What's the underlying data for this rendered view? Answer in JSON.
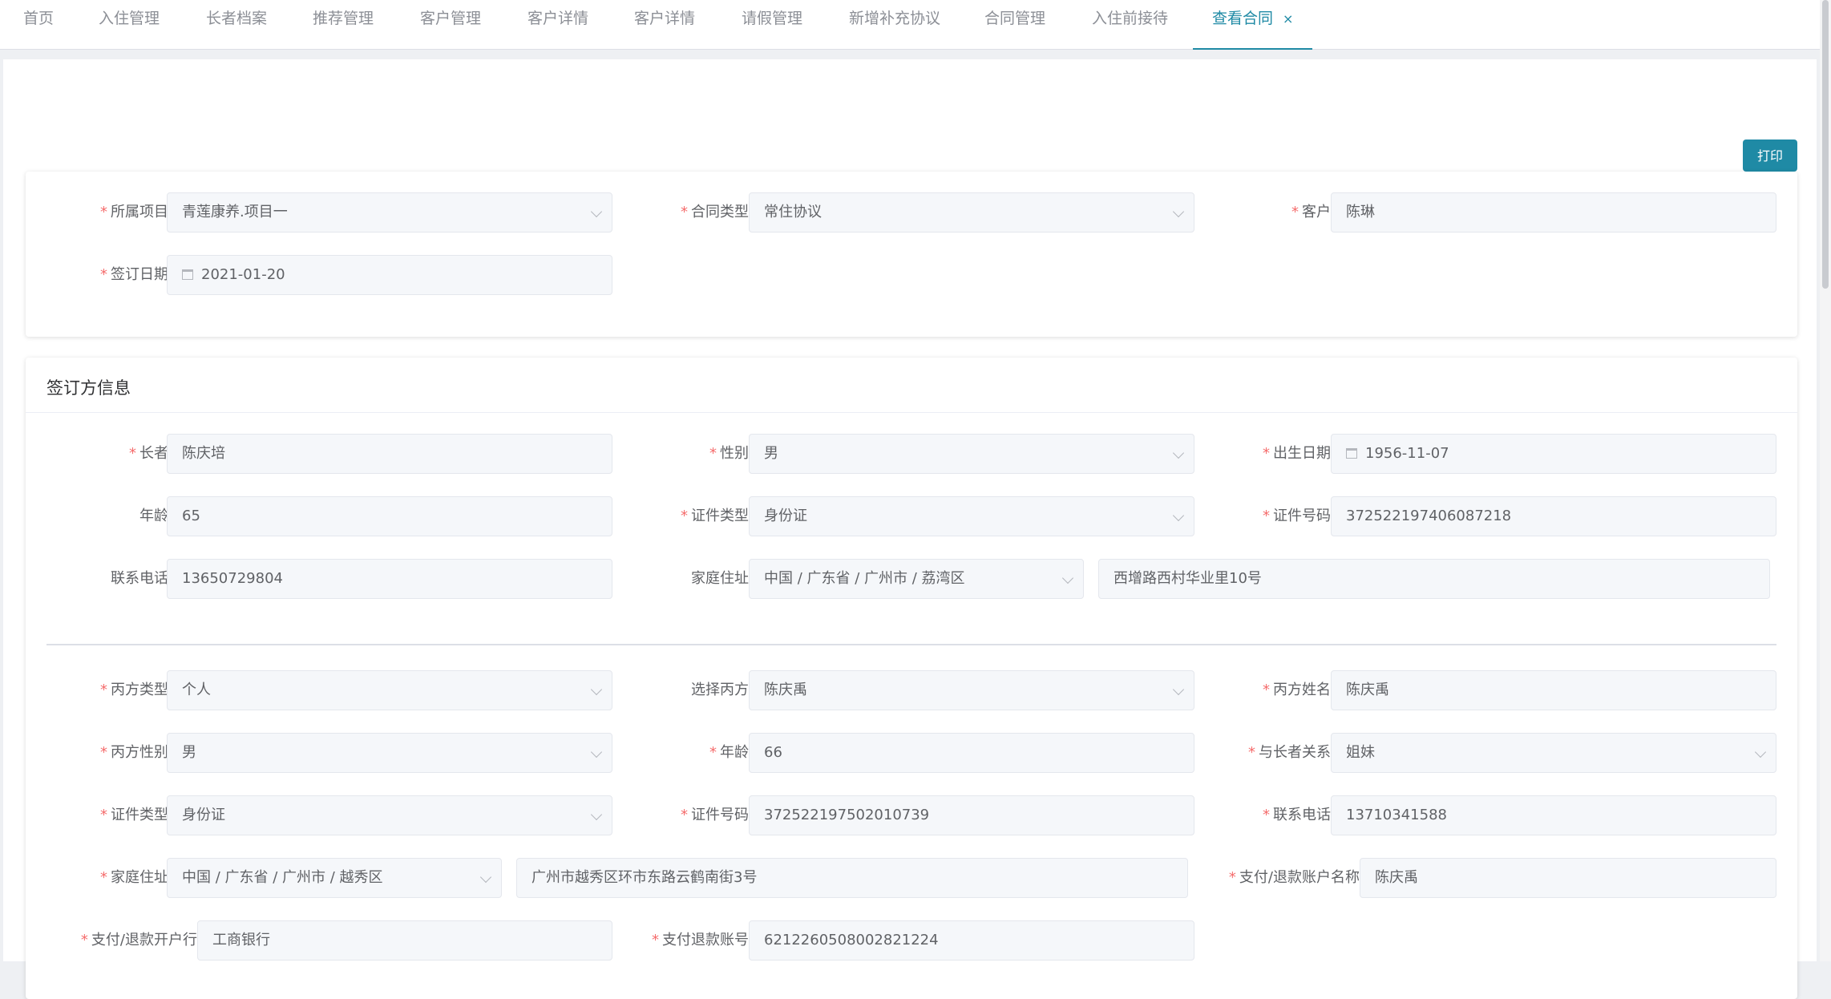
{
  "tabs": [
    {
      "label": "首页"
    },
    {
      "label": "入住管理"
    },
    {
      "label": "长者档案"
    },
    {
      "label": "推荐管理"
    },
    {
      "label": "客户管理"
    },
    {
      "label": "客户详情"
    },
    {
      "label": "客户详情"
    },
    {
      "label": "请假管理"
    },
    {
      "label": "新增补充协议"
    },
    {
      "label": "合同管理"
    },
    {
      "label": "入住前接待"
    },
    {
      "label": "查看合同"
    }
  ],
  "print_label": "打印",
  "contract": {
    "project_label": "所属项目",
    "project_value": "青莲康养.项目一",
    "type_label": "合同类型",
    "type_value": "常住协议",
    "customer_label": "客户",
    "customer_value": "陈琳",
    "date_label": "签订日期",
    "date_value": "2021-01-20"
  },
  "party": {
    "title": "签订方信息",
    "elder_label": "长者",
    "elder_value": "陈庆培",
    "gender_label": "性别",
    "gender_value": "男",
    "birth_label": "出生日期",
    "birth_value": "1956-11-07",
    "age_label": "年龄",
    "age_value": "65",
    "idtype_label": "证件类型",
    "idtype_value": "身份证",
    "idno_label": "证件号码",
    "idno_value": "372522197406087218",
    "phone_label": "联系电话",
    "phone_value": "13650729804",
    "addr_label": "家庭住址",
    "addr_region": "中国 / 广东省 / 广州市 / 荔湾区",
    "addr_detail": "西增路西村华业里10号"
  },
  "partyC": {
    "ctype_label": "丙方类型",
    "ctype_value": "个人",
    "select_label": "选择丙方",
    "select_value": "陈庆禹",
    "name_label": "丙方姓名",
    "name_value": "陈庆禹",
    "gender_label": "丙方性别",
    "gender_value": "男",
    "age_label": "年龄",
    "age_value": "66",
    "relation_label": "与长者关系",
    "relation_value": "姐妹",
    "idtype_label": "证件类型",
    "idtype_value": "身份证",
    "idno_label": "证件号码",
    "idno_value": "372522197502010739",
    "phone_label": "联系电话",
    "phone_value": "13710341588",
    "addr_label": "家庭住址",
    "addr_region": "中国 / 广东省 / 广州市 / 越秀区",
    "addr_detail": "广州市越秀区环市东路云鹤南街3号",
    "acctname_label": "支付/退款账户名称",
    "acctname_value": "陈庆禹",
    "bank_label": "支付/退款开户行",
    "bank_value": "工商银行",
    "acctno_label": "支付退款账号",
    "acctno_value": "6212260508002821224"
  }
}
